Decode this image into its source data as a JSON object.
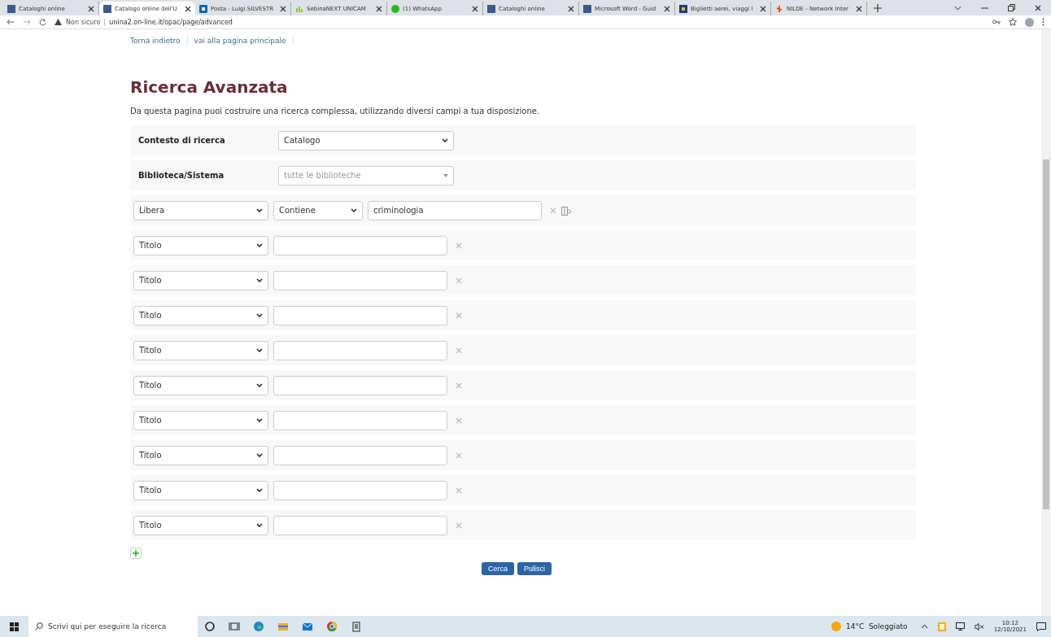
{
  "browser": {
    "tabs": [
      {
        "title": "Cataloghi online",
        "selected": false
      },
      {
        "title": "Catalogo online dell'U",
        "selected": true
      },
      {
        "title": "Posta - Luigi.SILVESTR",
        "selected": false
      },
      {
        "title": "SebinaNEXT UNICAM",
        "selected": false
      },
      {
        "title": "(1) WhatsApp",
        "selected": false
      },
      {
        "title": "Cataloghi online",
        "selected": false
      },
      {
        "title": "Microsoft Word - Guid",
        "selected": false
      },
      {
        "title": "Biglietti aerei, viaggi l",
        "selected": false
      },
      {
        "title": "NILDE - Network Inter",
        "selected": false
      }
    ],
    "security": "Non sicuro",
    "url": "unina2.on-line.it/opac/page/advanced"
  },
  "page": {
    "links": [
      "Torna indietro",
      "vai alla pagina principale"
    ],
    "title": "Ricerca Avanzata",
    "intro": "Da questa pagina puoi costruire una ricerca complessa, utilizzando diversi campi a tua disposizione.",
    "rows": [
      {
        "kind": "setting",
        "label": "Contesto di ricerca",
        "value": "Catalogo"
      },
      {
        "kind": "setting",
        "label": "Biblioteca/Sistema",
        "placeholder": "tutte le biblioteche"
      },
      {
        "kind": "query",
        "field": "Libera",
        "operator": "Contiene",
        "value": "criminologia"
      },
      {
        "kind": "query",
        "field": "Titolo"
      },
      {
        "kind": "query",
        "field": "Titolo"
      },
      {
        "kind": "query",
        "field": "Titolo"
      },
      {
        "kind": "query",
        "field": "Titolo"
      },
      {
        "kind": "query",
        "field": "Titolo"
      },
      {
        "kind": "query",
        "field": "Titolo"
      },
      {
        "kind": "query",
        "field": "Titolo"
      },
      {
        "kind": "query",
        "field": "Titolo"
      },
      {
        "kind": "query",
        "field": "Titolo"
      }
    ],
    "buttons": [
      "Cerca",
      "Pulisci"
    ]
  },
  "taskbar": {
    "search_placeholder": "Scrivi qui per eseguire la ricerca",
    "weather": "14°C  Soleggiato",
    "time": "10:12",
    "date": "12/10/2021"
  }
}
